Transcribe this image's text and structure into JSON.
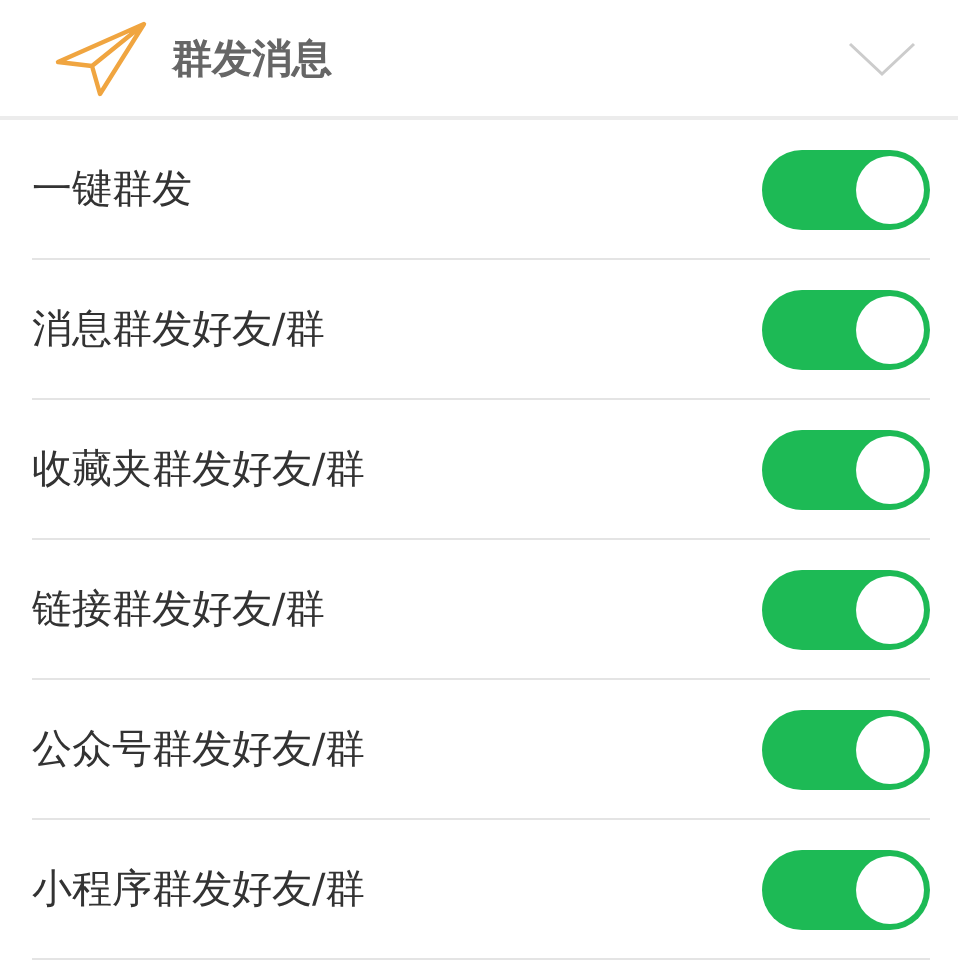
{
  "header": {
    "title": "群发消息",
    "expanded": false
  },
  "settings": [
    {
      "label": "一键群发",
      "on": true
    },
    {
      "label": "消息群发好友/群",
      "on": true
    },
    {
      "label": "收藏夹群发好友/群",
      "on": true
    },
    {
      "label": "链接群发好友/群",
      "on": true
    },
    {
      "label": "公众号群发好友/群",
      "on": true
    },
    {
      "label": "小程序群发好友/群",
      "on": true
    }
  ]
}
